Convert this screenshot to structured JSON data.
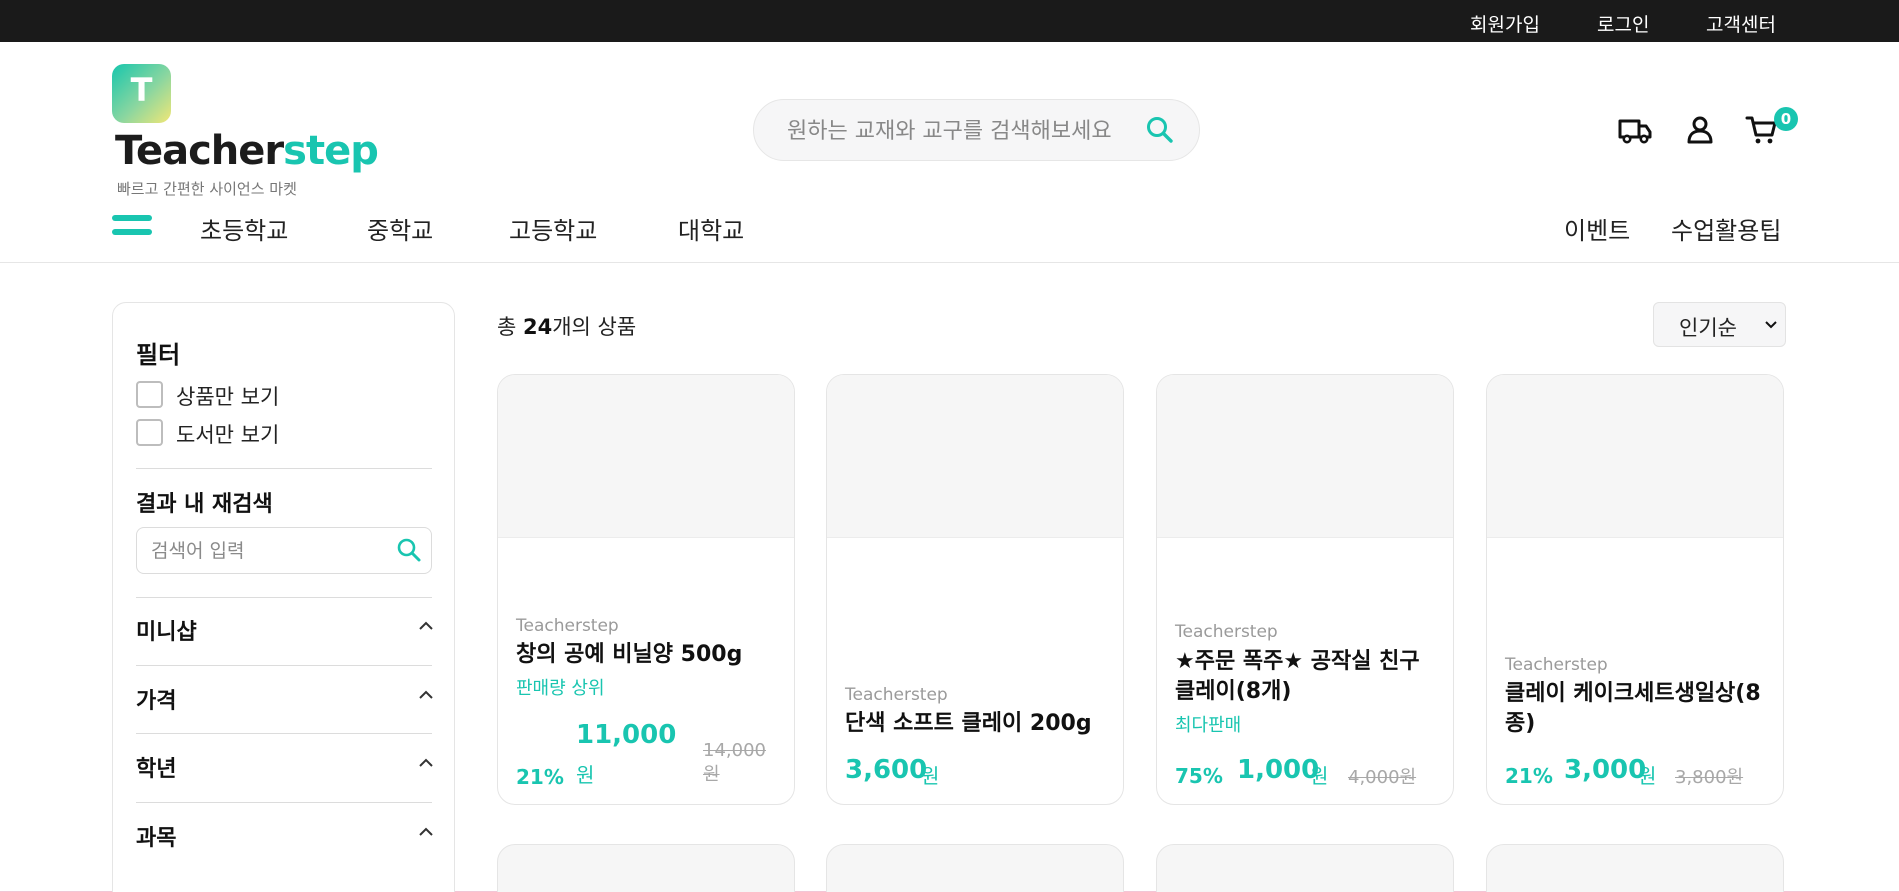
{
  "topbar": {
    "signup": "회원가입",
    "login": "로그인",
    "support": "고객센터"
  },
  "brand": {
    "logo_letter": "T",
    "name_part1": "Teacher",
    "name_part2": "step",
    "tagline": "빠르고 간편한 사이언스 마켓"
  },
  "search": {
    "placeholder": "원하는 교재와 교구를 검색해보세요"
  },
  "header": {
    "cart_count": "0"
  },
  "nav": {
    "categories": [
      "초등학교",
      "중학교",
      "고등학교",
      "대학교"
    ],
    "right_links": [
      "이벤트",
      "수업활용팁"
    ]
  },
  "filter": {
    "title": "필터",
    "options": [
      "상품만 보기",
      "도서만 보기"
    ],
    "research_title": "결과 내 재검색",
    "research_placeholder": "검색어 입력",
    "sections": [
      "미니샵",
      "가격",
      "학년",
      "과목"
    ]
  },
  "results": {
    "prefix": "총 ",
    "count": "24",
    "suffix": "개의 상품",
    "sort": "인기순"
  },
  "products": [
    {
      "brand": "Teacherstep",
      "name": "창의 공예 비닐양 500g",
      "tag": "판매량 상위",
      "discount": "21%",
      "price": "11,000",
      "currency": "원",
      "original": "14,000원"
    },
    {
      "brand": "Teacherstep",
      "name": "단색 소프트 클레이 200g",
      "tag": "",
      "discount": "",
      "price": "3,600",
      "currency": "원",
      "original": ""
    },
    {
      "brand": "Teacherstep",
      "name": "★주문 폭주★ 공작실 친구 클레이(8개)",
      "tag": "최다판매",
      "discount": "75%",
      "price": "1,000",
      "currency": "원",
      "original": "4,000원"
    },
    {
      "brand": "Teacherstep",
      "name": "클레이 케이크세트생일상(8종)",
      "tag": "",
      "discount": "21%",
      "price": "3,000",
      "currency": "원",
      "original": "3,800원"
    }
  ],
  "colors": {
    "accent": "#19c5b0",
    "topbar": "#1a1a1a",
    "text": "#111111",
    "muted": "#9a9a9a"
  },
  "icons": [
    "search-icon",
    "delivery-truck-icon",
    "user-icon",
    "cart-icon",
    "menu-icon",
    "chevron-up-icon",
    "chevron-down-icon"
  ]
}
